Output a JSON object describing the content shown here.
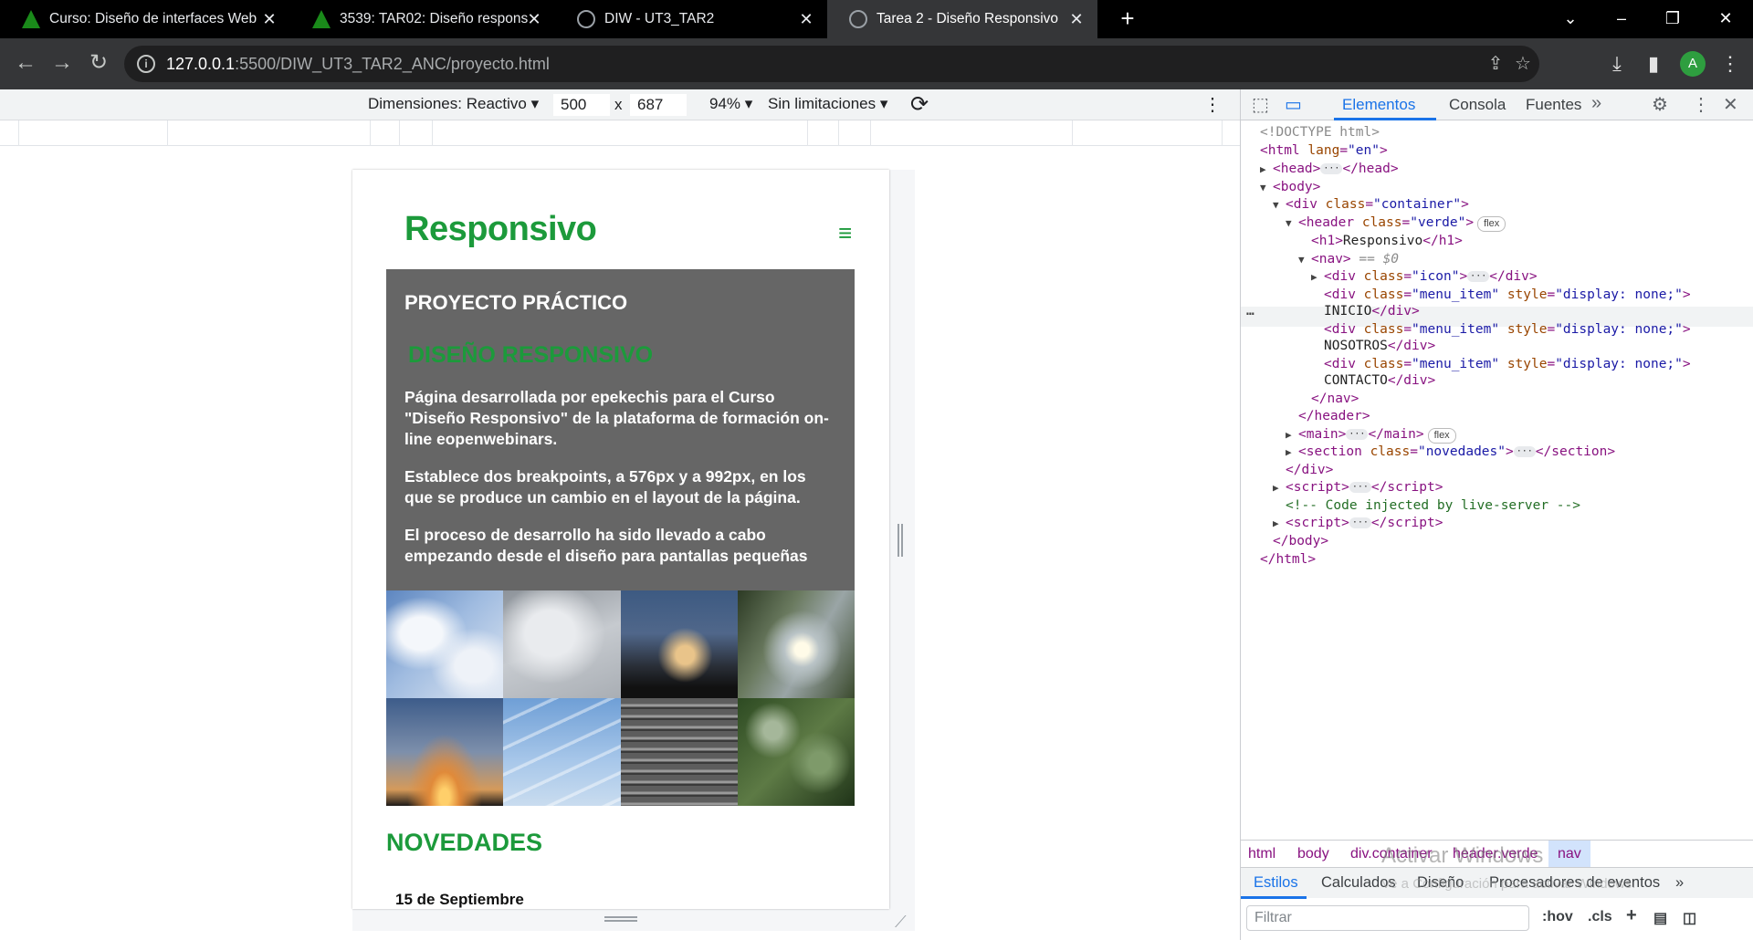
{
  "browser": {
    "tabs": [
      {
        "title": "Curso: Diseño de interfaces Web",
        "icon": "green-a-icon",
        "active": false
      },
      {
        "title": "3539: TAR02: Diseño responsivo",
        "icon": "green-a-icon",
        "active": false
      },
      {
        "title": "DIW - UT3_TAR2",
        "icon": "globe-icon",
        "active": false
      },
      {
        "title": "Tarea 2 - Diseño Responsivo",
        "icon": "globe-icon",
        "active": true
      }
    ],
    "new_tab": "+",
    "url_host": "127.0.0.1",
    "url_path": ":5500/DIW_UT3_TAR2_ANC/proyecto.html",
    "profile_initial": "A"
  },
  "device_toolbar": {
    "dimensions_label": "Dimensiones: Reactivo",
    "width": "500",
    "times": "x",
    "height": "687",
    "zoom": "94%",
    "throttle": "Sin limitaciones"
  },
  "page": {
    "title": "Responsivo",
    "menu_icon": "≡",
    "kicker": "PROYECTO PRÁCTICO",
    "headline": "DISEÑO RESPONSIVO",
    "paragraphs": [
      "Página desarrollada por epekechis para el Curso \"Diseño Responsivo\" de la plataforma de formación on-line eopenwebinars.",
      "Establece dos breakpoints, a 576px y a 992px, en los que se produce un cambio en el layout de la página.",
      "El proceso de desarrollo ha sido llevado a cabo empezando desde el diseño para pantallas pequeñas"
    ],
    "gallery_names": [
      "sky-clouds-photo",
      "gray-clouds-photo",
      "sunset-clouds-photo",
      "tree-sun-photo",
      "horizon-sunset-photo",
      "contrails-photo",
      "stairs-photo",
      "spiderweb-plants-photo"
    ],
    "novedades": "NOVEDADES",
    "date": "15 de Septiembre"
  },
  "devtools": {
    "tabs": [
      "Elementos",
      "Consola",
      "Fuentes"
    ],
    "dom": {
      "doctype": "<!DOCTYPE html>",
      "html_open": "<html",
      "lang_attr": "lang",
      "lang_val": "\"en\"",
      "head": "<head>",
      "head_close": "</head>",
      "body": "<body>",
      "div_container": "\"container\"",
      "header_class": "\"verde\"",
      "flex_badge": "flex",
      "h1_text": "Responsivo",
      "nav_marker": "== $0",
      "icon_class": "\"icon\"",
      "menu_item_class": "\"menu_item\"",
      "display_none": "\"display: none;\"",
      "items": [
        "INICIO",
        "NOSOTROS",
        "CONTACTO"
      ],
      "novedades_class": "\"novedades\"",
      "comment": "<!-- Code injected by live-server -->"
    },
    "breadcrumbs": [
      "html",
      "body",
      "div.container",
      "header.verde",
      "nav"
    ],
    "style_tabs": [
      "Estilos",
      "Calculados",
      "Diseño",
      "Procesadores de eventos"
    ],
    "filter_placeholder": "Filtrar",
    "hov": ":hov",
    "cls": ".cls",
    "watermark_title": "Activar Windows",
    "watermark_sub": "Ve a Configuración para activar Windows."
  }
}
